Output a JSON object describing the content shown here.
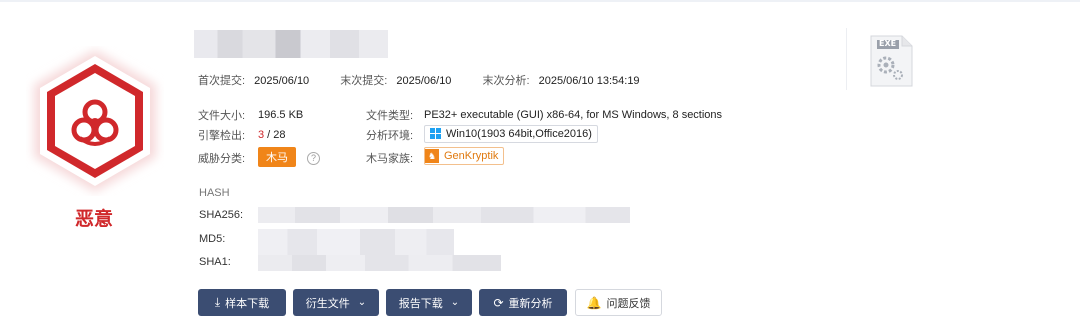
{
  "verdict": {
    "label": "恶意",
    "color": "#d0282b"
  },
  "dates": {
    "first_submit_label": "首次提交:",
    "first_submit_value": "2025/06/10",
    "last_submit_label": "末次提交:",
    "last_submit_value": "2025/06/10",
    "last_analysis_label": "末次分析:",
    "last_analysis_value": "2025/06/10 13:54:19"
  },
  "info": {
    "file_size_label": "文件大小:",
    "file_size_value": "196.5 KB",
    "file_type_label": "文件类型:",
    "file_type_value": "PE32+ executable (GUI) x86-64, for MS Windows, 8 sections",
    "engine_label": "引擎检出:",
    "engine_detected": "3",
    "engine_total": " / 28",
    "env_label": "分析环境:",
    "env_value": "Win10(1903 64bit,Office2016)",
    "threat_label": "威胁分类:",
    "threat_value": "木马",
    "family_label": "木马家族:",
    "family_value": "GenKryptik"
  },
  "hash": {
    "heading": "HASH",
    "sha256_label": "SHA256:",
    "md5_label": "MD5:",
    "sha1_label": "SHA1:"
  },
  "actions": {
    "sample_download": "样本下载",
    "derived_files": "衍生文件",
    "report_download": "报告下载",
    "reanalyze": "重新分析",
    "feedback": "问题反馈"
  },
  "file_icon": {
    "badge_text": "EXE"
  },
  "colors": {
    "accent": "#3b4d72",
    "danger": "#d0282b",
    "orange": "#f08519"
  }
}
